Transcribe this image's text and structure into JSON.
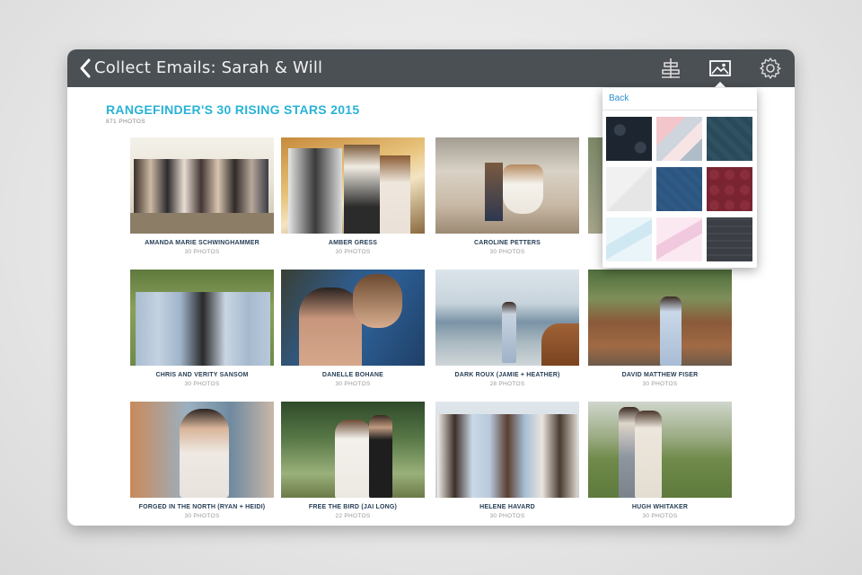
{
  "window": {
    "title": "Collect Emails: Sarah & Will",
    "icons": [
      "back-chevron-icon",
      "align-icon",
      "image-icon",
      "gear-icon"
    ]
  },
  "gallery": {
    "title": "RANGEFINDER'S 30 RISING STARS 2015",
    "count": "871 PHOTOS",
    "tiles": [
      {
        "name": "AMANDA MARIE SCHWINGHAMMER",
        "count": "30 PHOTOS"
      },
      {
        "name": "AMBER GRESS",
        "count": "30 PHOTOS"
      },
      {
        "name": "CAROLINE PETTERS",
        "count": "30 PHOTOS"
      },
      {
        "name": "",
        "count": ""
      },
      {
        "name": "CHRIS AND VERITY SANSOM",
        "count": "30 PHOTOS"
      },
      {
        "name": "DANELLE BOHANE",
        "count": "30 PHOTOS"
      },
      {
        "name": "DARK ROUX (JAMIE + HEATHER)",
        "count": "28 PHOTOS"
      },
      {
        "name": "DAVID MATTHEW FISER",
        "count": "30 PHOTOS"
      },
      {
        "name": "FORGED IN THE NORTH (RYAN + HEIDI)",
        "count": "30 PHOTOS"
      },
      {
        "name": "FREE THE BIRD (JAI LONG)",
        "count": "22 PHOTOS"
      },
      {
        "name": "HELENE HAVARD",
        "count": "30 PHOTOS"
      },
      {
        "name": "HUGH WHITAKER",
        "count": "30 PHOTOS"
      }
    ]
  },
  "popover": {
    "back_label": "Back",
    "swatches": [
      {
        "name": "black-damask",
        "color": "#1c2530"
      },
      {
        "name": "pastel-triangles",
        "color": "#f2c9cf"
      },
      {
        "name": "teal-pattern",
        "color": "#2a4a5a"
      },
      {
        "name": "light-gray",
        "color": "#eeeeee"
      },
      {
        "name": "blue-pattern",
        "color": "#2c5580"
      },
      {
        "name": "maroon-pattern",
        "color": "#7a2432"
      },
      {
        "name": "light-blue-chevron",
        "color": "#dff0f6"
      },
      {
        "name": "pink-chevron",
        "color": "#f7dceb"
      },
      {
        "name": "dark-plaid",
        "color": "#3b3f45"
      }
    ]
  }
}
